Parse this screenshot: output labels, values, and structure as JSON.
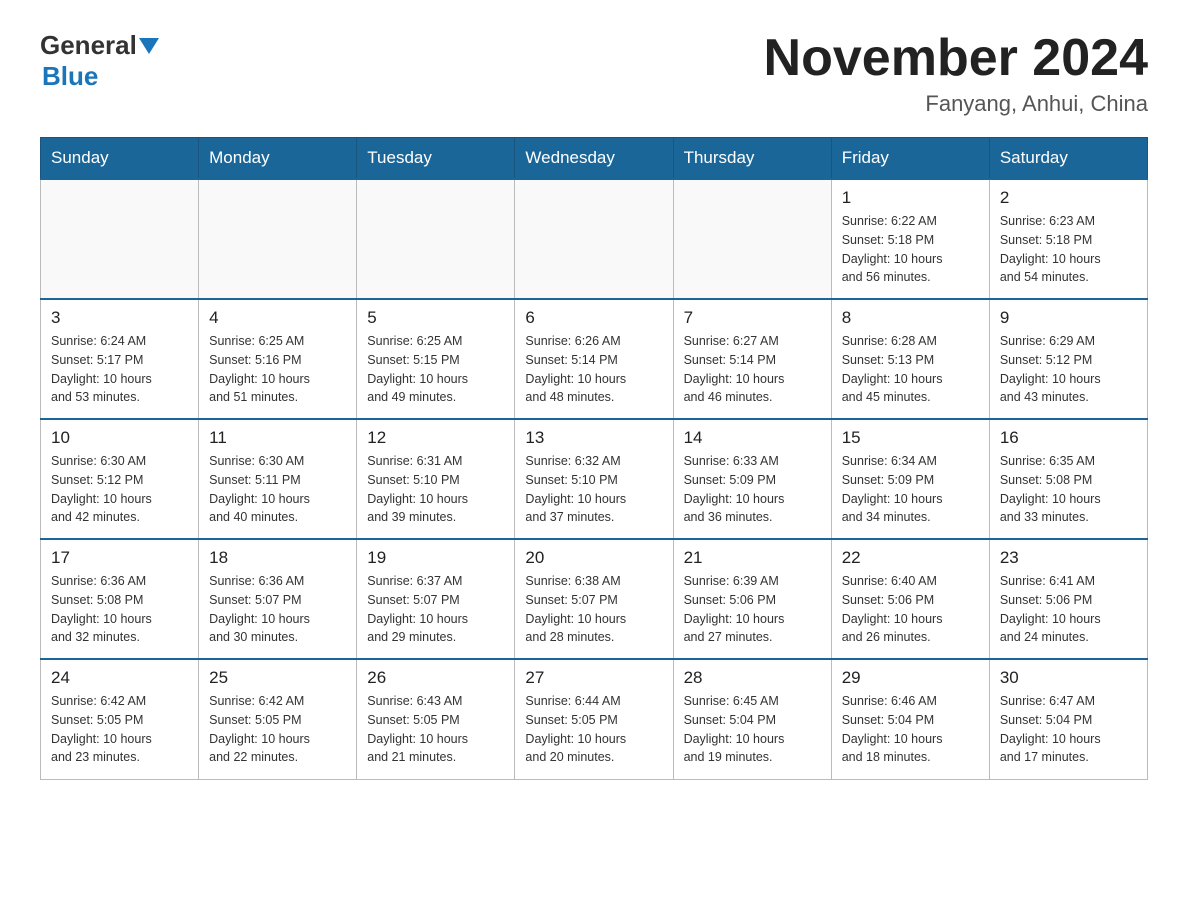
{
  "header": {
    "logo_general": "General",
    "logo_blue": "Blue",
    "month_title": "November 2024",
    "location": "Fanyang, Anhui, China"
  },
  "weekdays": [
    "Sunday",
    "Monday",
    "Tuesday",
    "Wednesday",
    "Thursday",
    "Friday",
    "Saturday"
  ],
  "weeks": [
    [
      {
        "day": "",
        "info": ""
      },
      {
        "day": "",
        "info": ""
      },
      {
        "day": "",
        "info": ""
      },
      {
        "day": "",
        "info": ""
      },
      {
        "day": "",
        "info": ""
      },
      {
        "day": "1",
        "info": "Sunrise: 6:22 AM\nSunset: 5:18 PM\nDaylight: 10 hours\nand 56 minutes."
      },
      {
        "day": "2",
        "info": "Sunrise: 6:23 AM\nSunset: 5:18 PM\nDaylight: 10 hours\nand 54 minutes."
      }
    ],
    [
      {
        "day": "3",
        "info": "Sunrise: 6:24 AM\nSunset: 5:17 PM\nDaylight: 10 hours\nand 53 minutes."
      },
      {
        "day": "4",
        "info": "Sunrise: 6:25 AM\nSunset: 5:16 PM\nDaylight: 10 hours\nand 51 minutes."
      },
      {
        "day": "5",
        "info": "Sunrise: 6:25 AM\nSunset: 5:15 PM\nDaylight: 10 hours\nand 49 minutes."
      },
      {
        "day": "6",
        "info": "Sunrise: 6:26 AM\nSunset: 5:14 PM\nDaylight: 10 hours\nand 48 minutes."
      },
      {
        "day": "7",
        "info": "Sunrise: 6:27 AM\nSunset: 5:14 PM\nDaylight: 10 hours\nand 46 minutes."
      },
      {
        "day": "8",
        "info": "Sunrise: 6:28 AM\nSunset: 5:13 PM\nDaylight: 10 hours\nand 45 minutes."
      },
      {
        "day": "9",
        "info": "Sunrise: 6:29 AM\nSunset: 5:12 PM\nDaylight: 10 hours\nand 43 minutes."
      }
    ],
    [
      {
        "day": "10",
        "info": "Sunrise: 6:30 AM\nSunset: 5:12 PM\nDaylight: 10 hours\nand 42 minutes."
      },
      {
        "day": "11",
        "info": "Sunrise: 6:30 AM\nSunset: 5:11 PM\nDaylight: 10 hours\nand 40 minutes."
      },
      {
        "day": "12",
        "info": "Sunrise: 6:31 AM\nSunset: 5:10 PM\nDaylight: 10 hours\nand 39 minutes."
      },
      {
        "day": "13",
        "info": "Sunrise: 6:32 AM\nSunset: 5:10 PM\nDaylight: 10 hours\nand 37 minutes."
      },
      {
        "day": "14",
        "info": "Sunrise: 6:33 AM\nSunset: 5:09 PM\nDaylight: 10 hours\nand 36 minutes."
      },
      {
        "day": "15",
        "info": "Sunrise: 6:34 AM\nSunset: 5:09 PM\nDaylight: 10 hours\nand 34 minutes."
      },
      {
        "day": "16",
        "info": "Sunrise: 6:35 AM\nSunset: 5:08 PM\nDaylight: 10 hours\nand 33 minutes."
      }
    ],
    [
      {
        "day": "17",
        "info": "Sunrise: 6:36 AM\nSunset: 5:08 PM\nDaylight: 10 hours\nand 32 minutes."
      },
      {
        "day": "18",
        "info": "Sunrise: 6:36 AM\nSunset: 5:07 PM\nDaylight: 10 hours\nand 30 minutes."
      },
      {
        "day": "19",
        "info": "Sunrise: 6:37 AM\nSunset: 5:07 PM\nDaylight: 10 hours\nand 29 minutes."
      },
      {
        "day": "20",
        "info": "Sunrise: 6:38 AM\nSunset: 5:07 PM\nDaylight: 10 hours\nand 28 minutes."
      },
      {
        "day": "21",
        "info": "Sunrise: 6:39 AM\nSunset: 5:06 PM\nDaylight: 10 hours\nand 27 minutes."
      },
      {
        "day": "22",
        "info": "Sunrise: 6:40 AM\nSunset: 5:06 PM\nDaylight: 10 hours\nand 26 minutes."
      },
      {
        "day": "23",
        "info": "Sunrise: 6:41 AM\nSunset: 5:06 PM\nDaylight: 10 hours\nand 24 minutes."
      }
    ],
    [
      {
        "day": "24",
        "info": "Sunrise: 6:42 AM\nSunset: 5:05 PM\nDaylight: 10 hours\nand 23 minutes."
      },
      {
        "day": "25",
        "info": "Sunrise: 6:42 AM\nSunset: 5:05 PM\nDaylight: 10 hours\nand 22 minutes."
      },
      {
        "day": "26",
        "info": "Sunrise: 6:43 AM\nSunset: 5:05 PM\nDaylight: 10 hours\nand 21 minutes."
      },
      {
        "day": "27",
        "info": "Sunrise: 6:44 AM\nSunset: 5:05 PM\nDaylight: 10 hours\nand 20 minutes."
      },
      {
        "day": "28",
        "info": "Sunrise: 6:45 AM\nSunset: 5:04 PM\nDaylight: 10 hours\nand 19 minutes."
      },
      {
        "day": "29",
        "info": "Sunrise: 6:46 AM\nSunset: 5:04 PM\nDaylight: 10 hours\nand 18 minutes."
      },
      {
        "day": "30",
        "info": "Sunrise: 6:47 AM\nSunset: 5:04 PM\nDaylight: 10 hours\nand 17 minutes."
      }
    ]
  ]
}
